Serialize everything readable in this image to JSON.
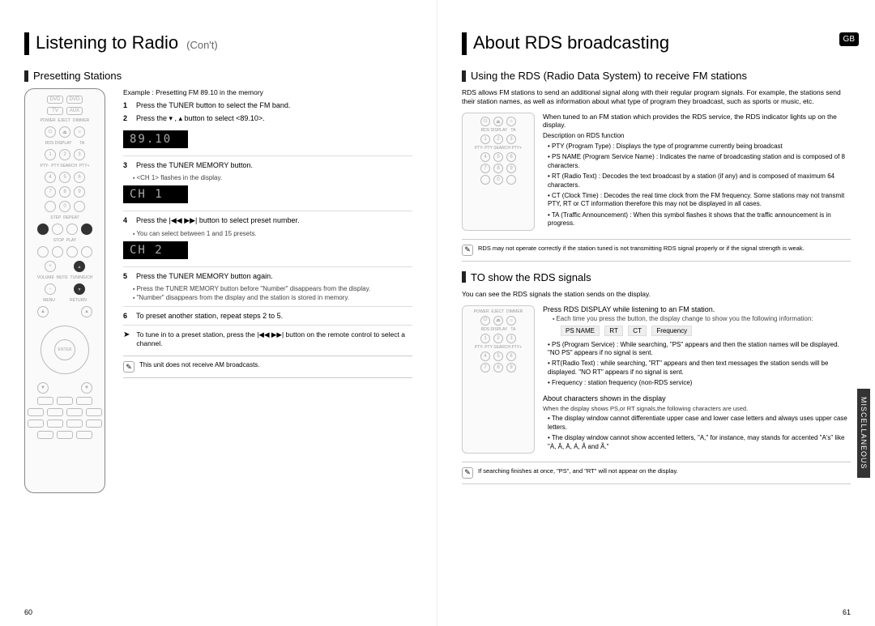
{
  "left": {
    "title": "Listening to Radio",
    "title_suffix": "(Con't)",
    "section": "Presetting Stations",
    "example": "Example : Presetting FM 89.10 in the memory",
    "steps": [
      {
        "n": "1",
        "text": "Press the TUNER button to select the FM band."
      },
      {
        "n": "2",
        "text": "Press the  ▾ , ▴  button to select <89.10>."
      },
      {
        "n": "3",
        "text": "Press the TUNER MEMORY button."
      },
      {
        "n": "4",
        "text": "Press the  |◀◀ ▶▶|  button to select preset number."
      },
      {
        "n": "5",
        "text": "Press the TUNER MEMORY button again."
      },
      {
        "n": "6",
        "text": "To preset another station, repeat steps 2 to 5."
      }
    ],
    "disp1": "89.10",
    "disp2": "CH 1",
    "disp3": "CH 2",
    "b3": "<CH 1> flashes in the display.",
    "b4": "You can select between 1 and 15 presets.",
    "b5a": "Press the TUNER MEMORY button before \"Number\" disappears from the display.",
    "b5b": "\"Number\" disappears from the display and the station is stored in memory.",
    "tune_in": "To tune in to a preset station, press the |◀◀ ▶▶| button on the remote control to select a channel.",
    "note": "This unit does not receive AM broadcasts.",
    "page_num": "60"
  },
  "right": {
    "title": "About RDS broadcasting",
    "gb": "GB",
    "section1": "Using the RDS (Radio Data System) to receive FM stations",
    "intro": "RDS allows FM stations to send an additional signal along with their regular program signals. For example, the stations send their station names, as well as information about what type of program they broadcast, such as sports or music, etc.",
    "tuned": "When tuned to an FM station which provides the RDS service, the RDS indicator lights up on the display.",
    "desc_head": "Description on RDS function",
    "desc": [
      "PTY (Program Type) : Displays the type of programme currently being broadcast",
      "PS NAME (Program Service Name) : Indicates the name of broadcasting station and is composed of 8 characters.",
      "RT (Radio Text) : Decodes the text broadcast by a station (if any) and is composed of maximum 64 characters.",
      "CT (Clock Time) : Decodes the real time clock from the FM frequency. Some stations may not transmit PTY, RT or CT information therefore this may not be displayed in all cases.",
      "TA (Traffic Announcement) : When this symbol flashes it shows that the traffic announcement is in progress."
    ],
    "note1": "RDS may not operate correctly if the station tuned is not transmitting RDS signal properly or if the signal strength is weak.",
    "section2": "TO show the RDS signals",
    "intro2": "You can see the RDS signals the station sends on the display.",
    "press": "Press RDS DISPLAY while listening to an FM station.",
    "press_b": "Each time you press the button, the display change to show you the following information:",
    "seq": [
      "PS NAME",
      "RT",
      "CT",
      "Frequency"
    ],
    "desc2": [
      "PS (Program Service) : While searching, \"PS\" appears and then the station names will be displayed. \"NO PS\" appears if no signal is sent.",
      "RT(Radio Text) : while searching, \"RT\" appears and then text messages the station sends will be displayed. \"NO RT\" appears if no signal is sent.",
      "Frequency : station frequency (non-RDS service)"
    ],
    "chars_head": "About characters shown in the display",
    "chars_sub": "When the display shows PS,or RT signals,the following characters are used.",
    "chars": [
      "The display window cannot differentiate upper case and lower case letters and always uses upper case letters.",
      "The display window cannot show accented letters, \"A,\" for instance, may stands for accented \"A's\" like \"À, Â, Ä, Á, Å and Ã.\""
    ],
    "note2": "If searching finishes at once, \"PS\", and \"RT\" will not appear on the display.",
    "side_tab": "MISCELLANEOUS",
    "page_num": "61"
  }
}
